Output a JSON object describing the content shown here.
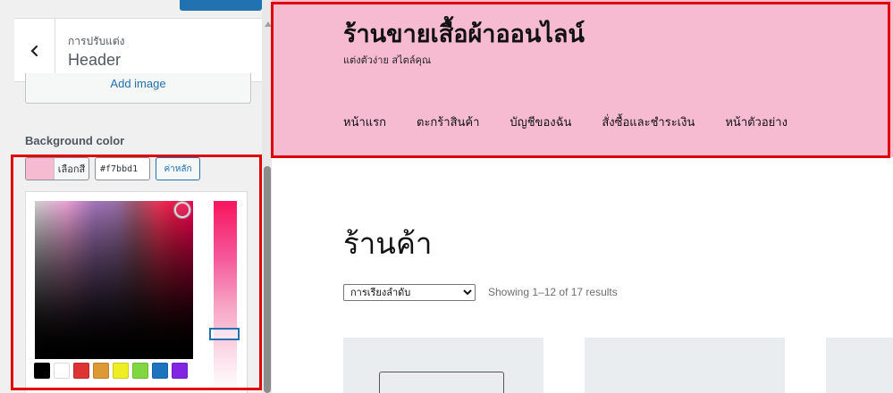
{
  "sidebar": {
    "breadcrumb": "การปรับแต่ง",
    "panel_title": "Header",
    "add_image_label": "Add image",
    "background_color_label": "Background color",
    "select_color_label": "เลือกสี",
    "hex_value": "#f7bbd1",
    "default_label": "ค่าหลัก",
    "current_color": "#f7bbd1",
    "palette": [
      "#000000",
      "#ffffff",
      "#dd3333",
      "#dd9933",
      "#eeee22",
      "#81d742",
      "#1e73be",
      "#8224e3"
    ],
    "icons": {
      "back": "chevron-left-icon"
    }
  },
  "preview": {
    "site_title": "ร้านขายเสื้อผ้าออนไลน์",
    "tagline": "แต่งตัวง่าย สไตล์คุณ",
    "nav": [
      "หน้าแรก",
      "ตะกร้าสินค้า",
      "บัญชีของฉัน",
      "สั่งซื้อและชำระเงิน",
      "หน้าตัวอย่าง"
    ],
    "header_color": "#f7bbd1",
    "shop_title": "ร้านค้า",
    "sort_selected": "การเรียงลำดับ",
    "result_count": "Showing 1–12 of 17 results"
  },
  "highlight_color": "#e00000"
}
